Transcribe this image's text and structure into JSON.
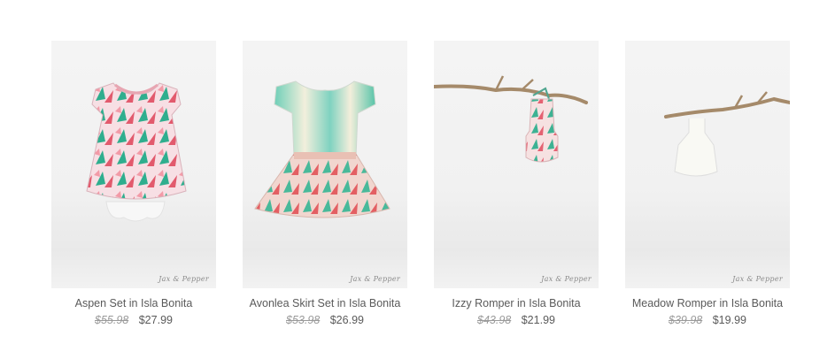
{
  "products": [
    {
      "title": "Aspen Set in Isla Bonita",
      "old_price": "$55.98",
      "price": "$27.99",
      "brand": "Jax & Pepper"
    },
    {
      "title": "Avonlea Skirt Set in Isla Bonita",
      "old_price": "$53.98",
      "price": "$26.99",
      "brand": "Jax & Pepper"
    },
    {
      "title": "Izzy Romper in Isla Bonita",
      "old_price": "$43.98",
      "price": "$21.99",
      "brand": "Jax & Pepper"
    },
    {
      "title": "Meadow Romper in Isla Bonita",
      "old_price": "$39.98",
      "price": "$19.99",
      "brand": "Jax & Pepper"
    }
  ]
}
